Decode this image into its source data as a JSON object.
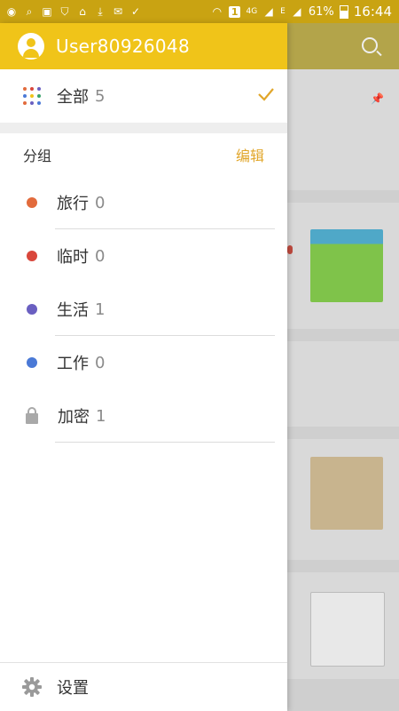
{
  "status_bar": {
    "network": "4G",
    "sim": "1",
    "battery": "61%",
    "time": "16:44",
    "edge": "E"
  },
  "drawer": {
    "username": "User80926048",
    "all": {
      "label": "全部",
      "count": "5"
    },
    "groups_title": "分组",
    "edit_label": "编辑",
    "groups": [
      {
        "label": "旅行",
        "count": "0",
        "color": "#e26b3c"
      },
      {
        "label": "临时",
        "count": "0",
        "color": "#d9473c"
      },
      {
        "label": "生活",
        "count": "1",
        "color": "#6a5fc1"
      },
      {
        "label": "工作",
        "count": "0",
        "color": "#4a79d6"
      }
    ],
    "locked": {
      "label": "加密",
      "count": "1"
    },
    "settings_label": "设置"
  },
  "colors": {
    "accent": "#f0c419",
    "edit": "#e1a62a"
  }
}
